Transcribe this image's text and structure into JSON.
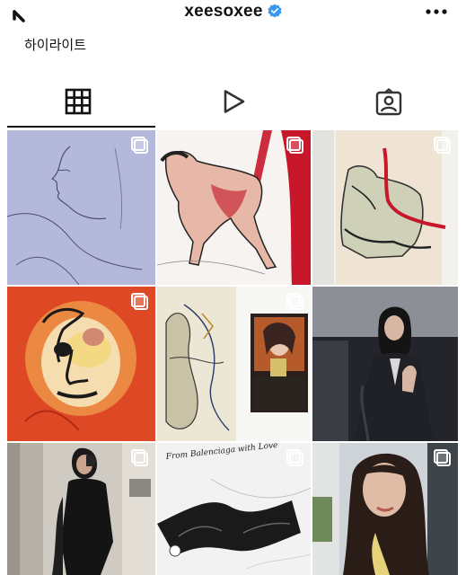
{
  "header": {
    "username": "xeesoxee",
    "back_icon": "back-arrow-icon",
    "verified_icon": "verified-badge-icon",
    "more_icon": "more-options-icon"
  },
  "highlights": {
    "label": "하이라이트"
  },
  "tabs": [
    {
      "icon": "grid-icon",
      "active": true
    },
    {
      "icon": "reels-play-icon",
      "active": false
    },
    {
      "icon": "tagged-person-icon",
      "active": false
    }
  ],
  "grid": {
    "posts": [
      {
        "subject": "blue pencil sketch of a face",
        "multiple": true
      },
      {
        "subject": "crawling figure drawing with red strokes",
        "multiple": true
      },
      {
        "subject": "abstract figure drawing with red lines",
        "multiple": true
      },
      {
        "subject": "red painted portrait",
        "multiple": true
      },
      {
        "subject": "sketch collage with small photo",
        "multiple": true
      },
      {
        "subject": "woman in dark suit in car",
        "multiple": false
      },
      {
        "subject": "mirror selfie in black outfit",
        "multiple": true
      },
      {
        "subject": "handwritten note with black bra drawing",
        "multiple": true
      },
      {
        "subject": "selfie portrait with dark hair",
        "multiple": true
      }
    ],
    "handwritten_note": "From Balenciaga with Love"
  },
  "colors": {
    "verified": "#3897f0",
    "text": "#111111",
    "divider": "#dbdbdb"
  }
}
